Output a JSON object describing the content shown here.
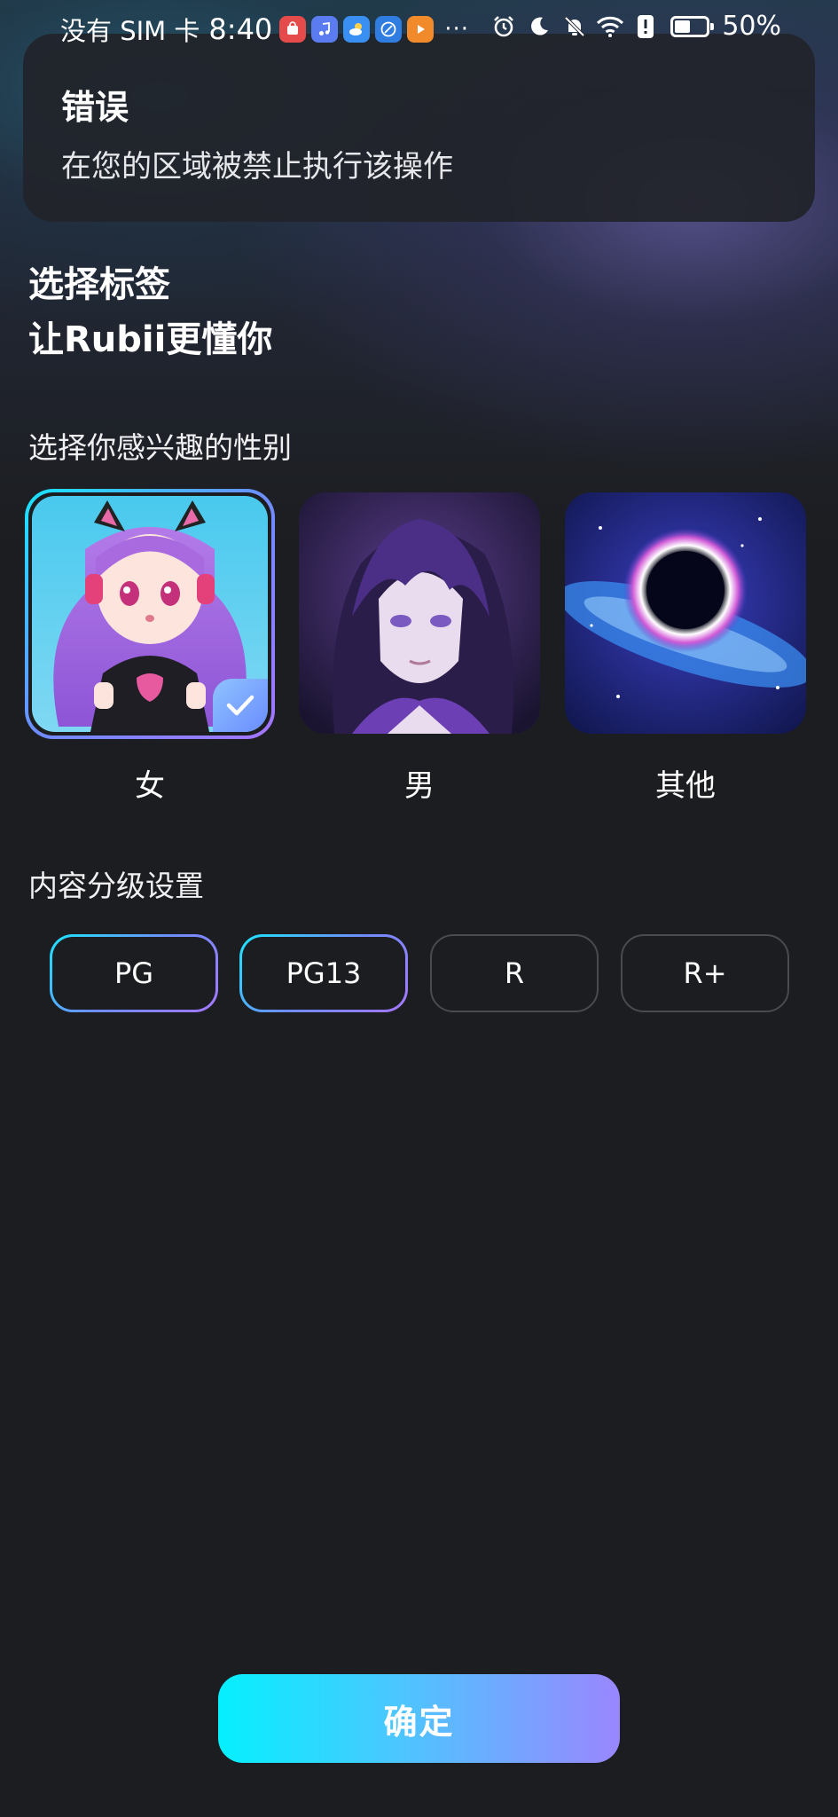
{
  "status_bar": {
    "carrier": "没有 SIM 卡",
    "time": "8:40",
    "more": "···",
    "battery_percent": "50%",
    "battery_level": 0.5,
    "app_icons": [
      "huawei-store-icon",
      "music-icon",
      "weather-icon",
      "browser-icon",
      "video-icon"
    ],
    "right_icons": [
      "alarm-icon",
      "moon-icon",
      "bell-off-icon",
      "wifi-icon",
      "notification-icon"
    ]
  },
  "toast": {
    "title": "错误",
    "message": "在您的区域被禁止执行该操作"
  },
  "headline": {
    "line1": "选择标签",
    "line2": "让Rubii更懂你"
  },
  "gender_section": {
    "label": "选择你感兴趣的性别",
    "options": [
      {
        "label": "女",
        "selected": true,
        "image": "anime-girl-cat-ears-image"
      },
      {
        "label": "男",
        "selected": false,
        "image": "anime-boy-purple-hair-image"
      },
      {
        "label": "其他",
        "selected": false,
        "image": "black-hole-galaxy-image"
      }
    ]
  },
  "rating_section": {
    "label": "内容分级设置",
    "options": [
      {
        "label": "PG",
        "selected": true
      },
      {
        "label": "PG13",
        "selected": true
      },
      {
        "label": "R",
        "selected": false
      },
      {
        "label": "R+",
        "selected": false
      }
    ]
  },
  "confirm_button": "确定",
  "colors": {
    "background": "#1c1d20",
    "accent_cyan": "#05f0ff",
    "accent_purple": "#9a86ff",
    "toast_bg": "#21242a"
  }
}
